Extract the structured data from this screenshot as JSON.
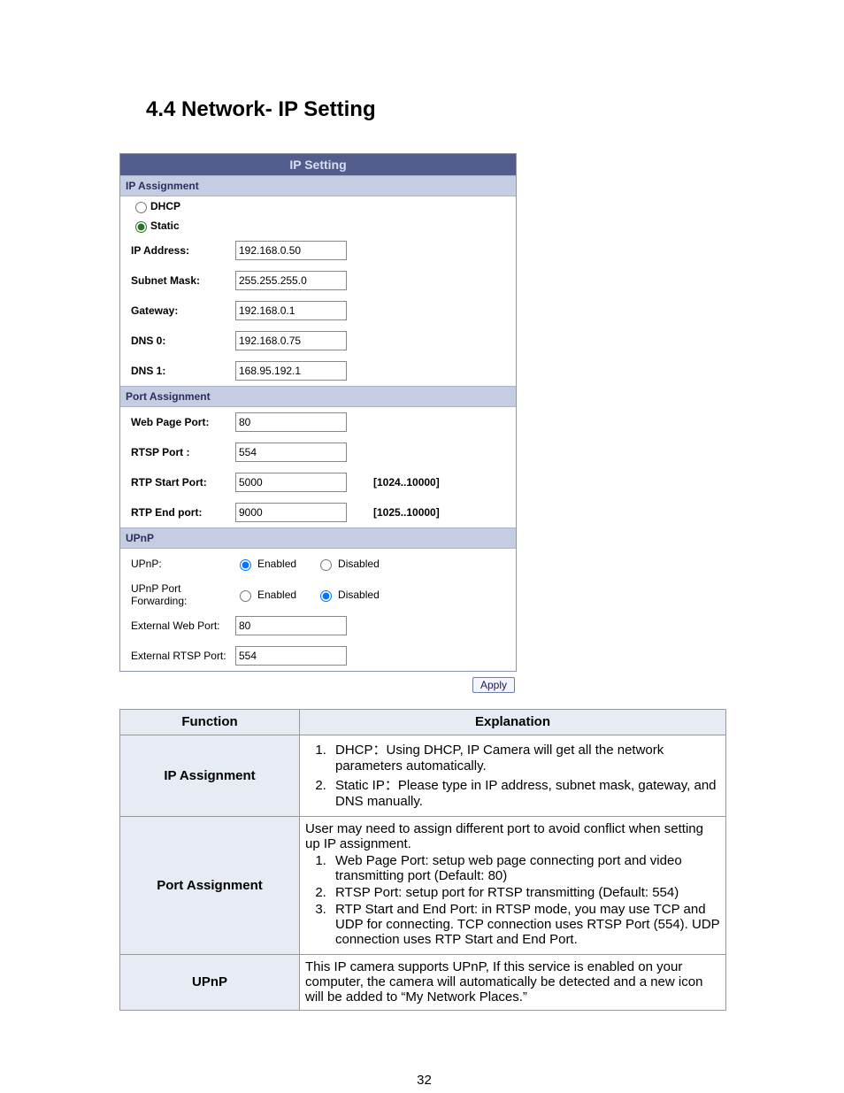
{
  "page_number": "32",
  "heading": "4.4 Network- IP Setting",
  "panel": {
    "title": "IP Setting",
    "ip_assignment": {
      "section": "IP Assignment",
      "dhcp_label": "DHCP",
      "static_label": "Static",
      "selected": "static",
      "fields": {
        "ip_address": {
          "label": "IP Address:",
          "value": "192.168.0.50"
        },
        "subnet_mask": {
          "label": "Subnet Mask:",
          "value": "255.255.255.0"
        },
        "gateway": {
          "label": "Gateway:",
          "value": "192.168.0.1"
        },
        "dns0": {
          "label": "DNS 0:",
          "value": "192.168.0.75"
        },
        "dns1": {
          "label": "DNS 1:",
          "value": "168.95.192.1"
        }
      }
    },
    "port_assignment": {
      "section": "Port Assignment",
      "fields": {
        "web_port": {
          "label": "Web Page Port:",
          "value": "80"
        },
        "rtsp_port": {
          "label": "RTSP Port :",
          "value": "554"
        },
        "rtp_start": {
          "label": "RTP Start Port:",
          "value": "5000",
          "hint": "[1024..10000]"
        },
        "rtp_end": {
          "label": "RTP End port:",
          "value": "9000",
          "hint": "[1025..10000]"
        }
      }
    },
    "upnp": {
      "section": "UPnP",
      "upnp_row": {
        "label": "UPnP:",
        "enabled_label": "Enabled",
        "disabled_label": "Disabled",
        "selected": "enabled"
      },
      "fw_row": {
        "label": "UPnP Port Forwarding:",
        "enabled_label": "Enabled",
        "disabled_label": "Disabled",
        "selected": "disabled"
      },
      "ext_web": {
        "label": "External Web Port:",
        "value": "80"
      },
      "ext_rtsp": {
        "label": "External RTSP Port:",
        "value": "554"
      }
    },
    "apply": "Apply"
  },
  "table": {
    "head": {
      "function": "Function",
      "explanation": "Explanation"
    },
    "rows": {
      "ip": {
        "function": "IP Assignment",
        "items": [
          "DHCP：Using DHCP, IP Camera will get all the network parameters automatically.",
          "Static IP：Please type in IP address, subnet mask, gateway, and DNS manually."
        ]
      },
      "port": {
        "function": "Port Assignment",
        "lead": "User may need to assign different port to avoid conflict when setting up IP assignment.",
        "items": [
          "Web Page Port: setup web page connecting port and video transmitting port (Default: 80)",
          "RTSP Port: setup port for RTSP transmitting (Default: 554)",
          "RTP Start and End Port: in RTSP mode, you may use TCP and UDP for connecting. TCP connection uses RTSP Port (554). UDP connection uses RTP Start and End Port."
        ]
      },
      "upnp": {
        "function": "UPnP",
        "text": "This IP camera supports UPnP, If this service is enabled on your computer, the camera will automatically be detected and a new icon will be added to “My Network Places.”"
      }
    }
  }
}
